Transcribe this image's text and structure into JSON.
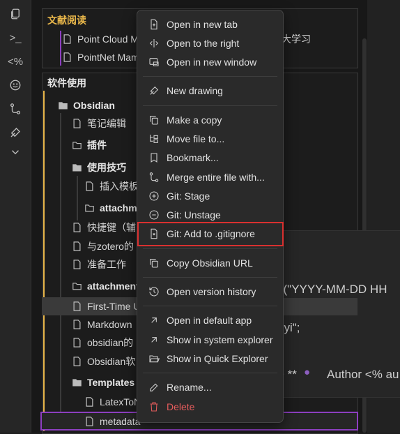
{
  "ribbon": {
    "icons": [
      "files-icon",
      "terminal-icon",
      "template-icon",
      "smile-icon",
      "git-icon",
      "drawing-icon",
      "chevron-down-icon"
    ],
    "terminal_glyph": ">_",
    "template_glyph": "<%"
  },
  "tree": {
    "groups": [
      {
        "title": "文献阅读",
        "items": [
          {
            "label": "Point Cloud M"
          },
          {
            "label": "PointNet Mam"
          }
        ],
        "partial_text": "大学习"
      },
      {
        "title": "软件使用",
        "items": [
          {
            "label": "Obsidian",
            "type": "folder"
          },
          {
            "label": "笔记编辑",
            "type": "file"
          },
          {
            "label": "插件",
            "type": "folder-closed"
          },
          {
            "label": "使用技巧",
            "type": "folder"
          },
          {
            "label": "插入模板",
            "type": "file"
          },
          {
            "label": "attachm",
            "type": "folder-closed"
          },
          {
            "label": "快捷键（辅",
            "type": "file"
          },
          {
            "label": "与zotero的",
            "type": "file"
          },
          {
            "label": "准备工作",
            "type": "file"
          },
          {
            "label": "attachment",
            "type": "folder-closed"
          },
          {
            "label": "First-Time U",
            "type": "file"
          },
          {
            "label": "Markdown",
            "type": "file"
          },
          {
            "label": "obsidian的",
            "type": "file"
          },
          {
            "label": "Obsidian软",
            "type": "file"
          },
          {
            "label": "Templates",
            "type": "folder"
          },
          {
            "label": "LatexToN",
            "type": "file"
          },
          {
            "label": "metadata",
            "type": "file"
          }
        ]
      }
    ]
  },
  "preview": {
    "line1": "y(\"YYYY-MM-DD HH",
    "line2": "gyi\";",
    "line3": "> **",
    "line3b": "Author <% au"
  },
  "menu": {
    "items": [
      {
        "label": "Open in new tab",
        "icon": "file-plus-icon"
      },
      {
        "label": "Open to the right",
        "icon": "split-icon"
      },
      {
        "label": "Open in new window",
        "icon": "window-icon"
      },
      {
        "label": "New drawing",
        "icon": "drawing-icon"
      },
      {
        "label": "Make a copy",
        "icon": "copy-icon"
      },
      {
        "label": "Move file to...",
        "icon": "folder-tree-icon"
      },
      {
        "label": "Bookmark...",
        "icon": "bookmark-icon"
      },
      {
        "label": "Merge entire file with...",
        "icon": "git-merge-icon"
      },
      {
        "label": "Git: Stage",
        "icon": "plus-circle-icon"
      },
      {
        "label": "Git: Unstage",
        "icon": "minus-circle-icon"
      },
      {
        "label": "Git: Add to .gitignore",
        "icon": "file-x-icon"
      },
      {
        "label": "Copy Obsidian URL",
        "icon": "copy-icon"
      },
      {
        "label": "Open version history",
        "icon": "history-icon"
      },
      {
        "label": "Open in default app",
        "icon": "arrow-up-right-icon"
      },
      {
        "label": "Show in system explorer",
        "icon": "arrow-up-right-icon"
      },
      {
        "label": "Show in Quick Explorer",
        "icon": "folder-open-icon"
      },
      {
        "label": "Rename...",
        "icon": "pencil-icon"
      },
      {
        "label": "Delete",
        "icon": "trash-icon"
      }
    ]
  },
  "colors": {
    "accent_purple": "#8d3fc0",
    "heading_gold": "#e8b64a",
    "highlight_red": "#d9302f",
    "danger": "#e45c5c"
  }
}
